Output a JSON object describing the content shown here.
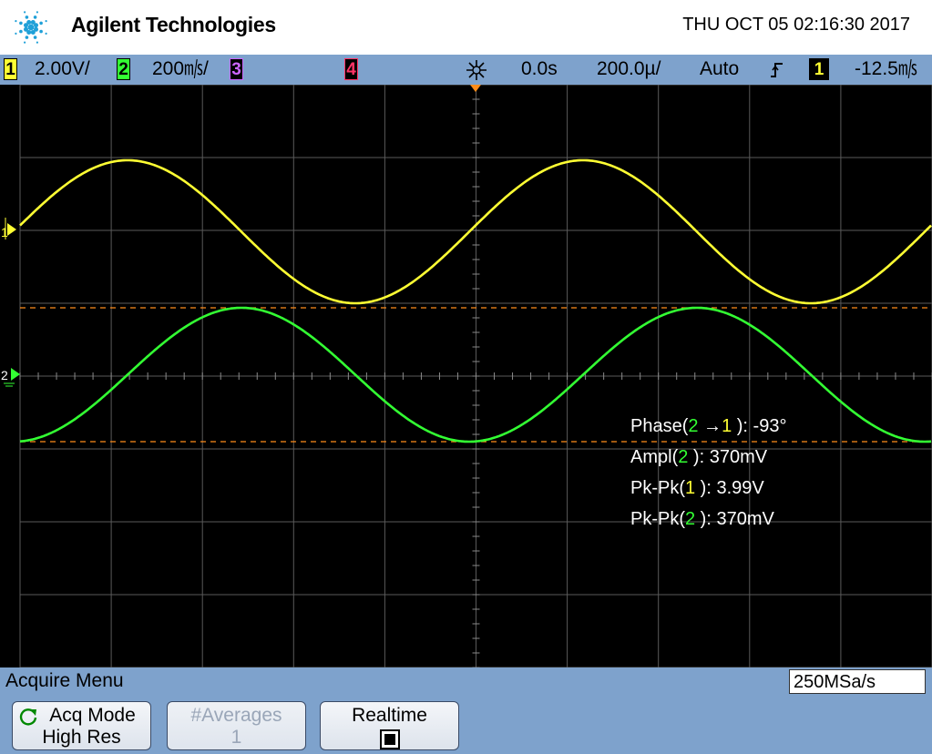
{
  "header": {
    "brand": "Agilent Technologies",
    "datetime": "THU OCT 05 02:16:30 2017"
  },
  "status_bar": {
    "ch1": {
      "num": "1",
      "scale": "2.00V/",
      "color": "#ffff33"
    },
    "ch2": {
      "num": "2",
      "scale": "200㎧/",
      "color": "#33ff33"
    },
    "ch3": {
      "num": "3",
      "color": "#cc66ff"
    },
    "ch4": {
      "num": "4",
      "color": "#ff3366"
    },
    "delay": "0.0s",
    "timebase": "200.0µ/",
    "trigger_mode": "Auto",
    "trigger_icon": "rising-edge-icon",
    "trigger_source": "1",
    "trigger_level": "-12.5㎧"
  },
  "screen": {
    "ch1_marker": "1",
    "ch2_marker": "2",
    "colors": {
      "ch1": "#ffff33",
      "ch2": "#33ff33",
      "cursor": "#ff8c1a",
      "grid": "#5a5a5a"
    }
  },
  "measurements": {
    "phase": {
      "label": "Phase(",
      "src_a": "2",
      "arrow": " →",
      "src_b": "1",
      "suffix": " ): ",
      "value": "-93°"
    },
    "ampl2": {
      "label": "Ampl(",
      "src": "2",
      "suffix": " ): ",
      "value": "370mV"
    },
    "pkpk1": {
      "label": "Pk-Pk(",
      "src": "1",
      "suffix": " ): ",
      "value": "3.99V"
    },
    "pkpk2": {
      "label": "Pk-Pk(",
      "src": "2",
      "suffix": " ): ",
      "value": "370mV"
    }
  },
  "menu": {
    "title": "Acquire Menu",
    "sample_rate": "250MSa/s",
    "softkeys": [
      {
        "line1": "Acq Mode",
        "line2": "High Res"
      },
      {
        "line1": "#Averages",
        "line2": "1"
      },
      {
        "line1": "Realtime"
      }
    ]
  }
}
